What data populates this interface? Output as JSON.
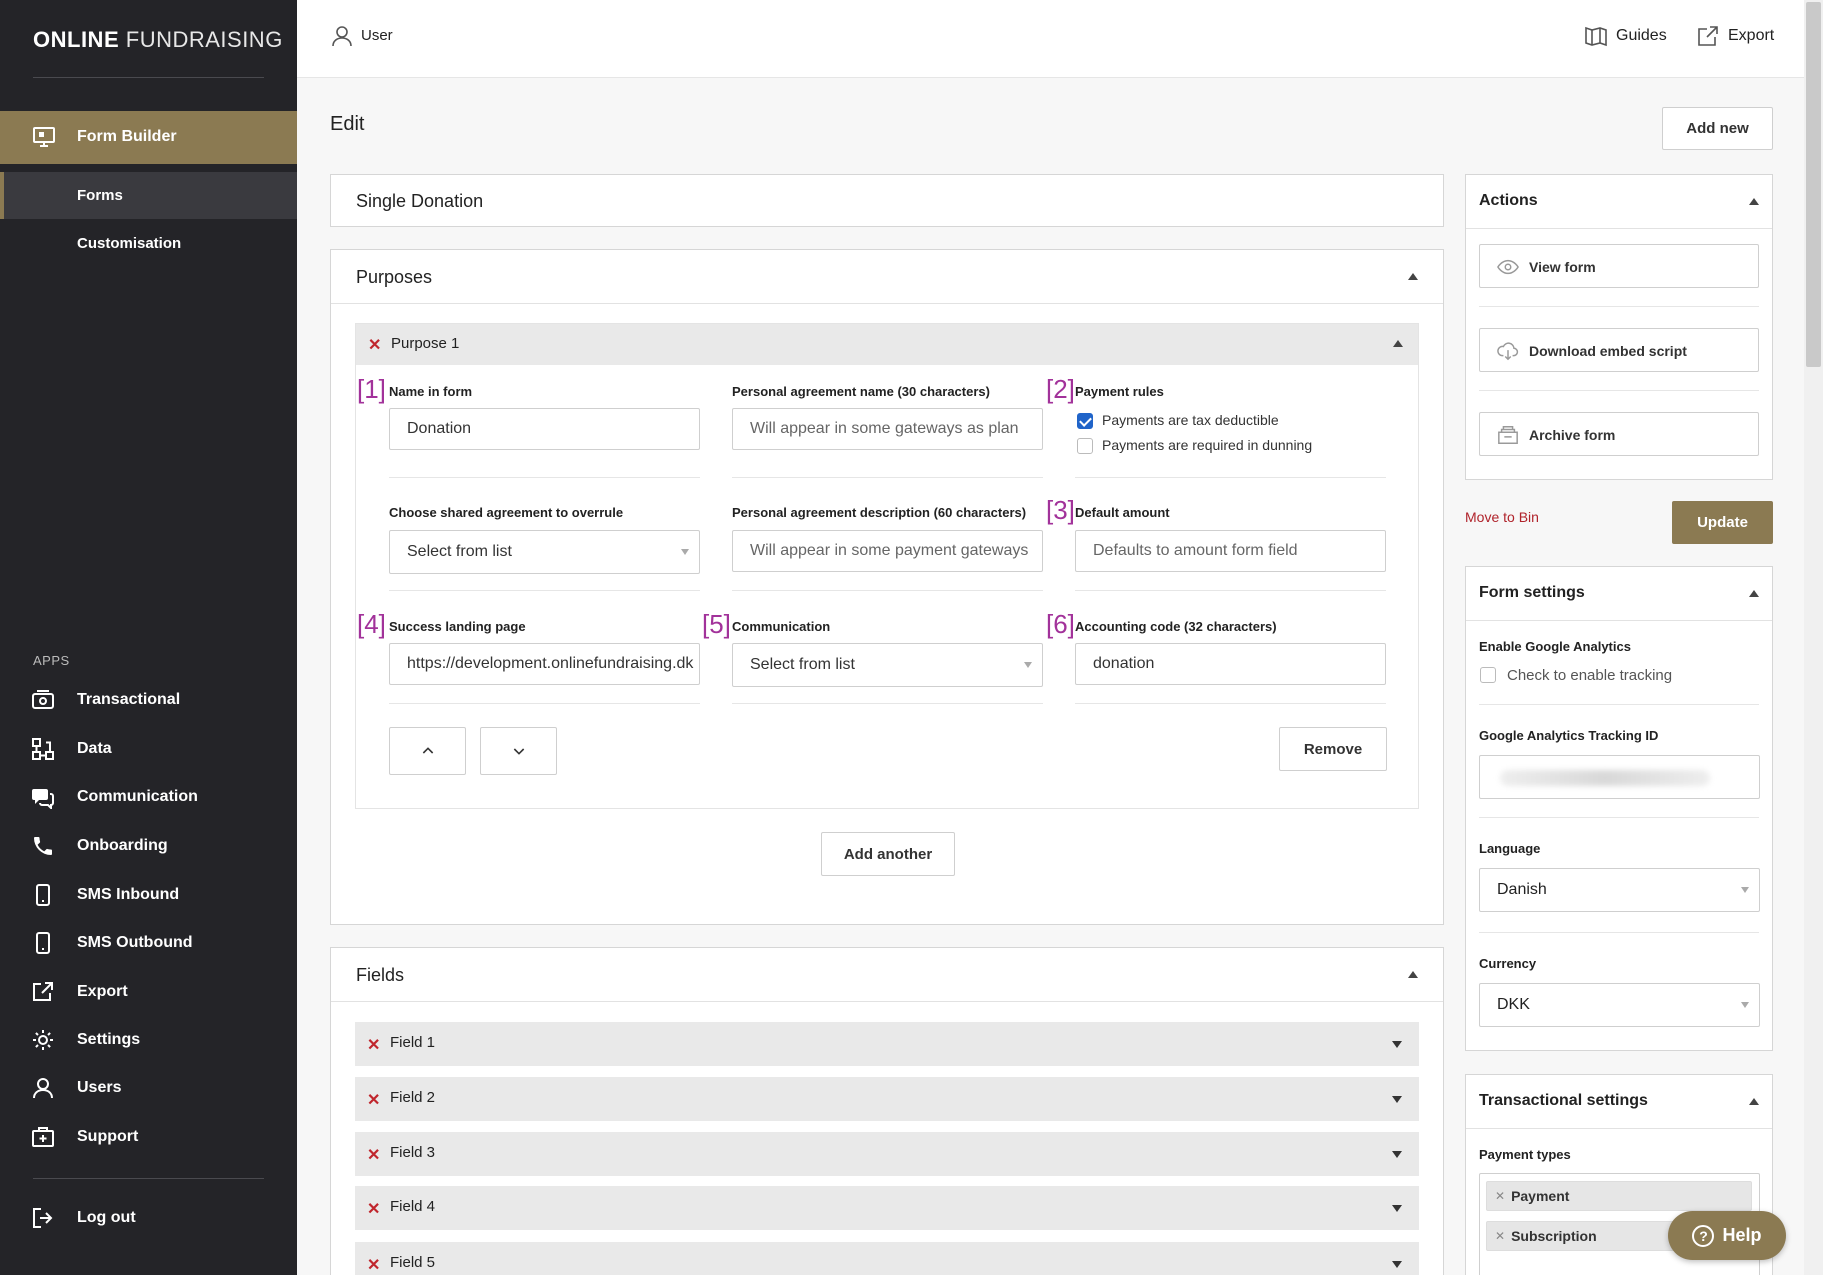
{
  "brand": {
    "bold": "ONLINE",
    "rest": "FUNDRAISING"
  },
  "sidebar": {
    "main_item": "Form Builder",
    "sub_items": [
      "Forms",
      "Customisation"
    ],
    "apps_label": "APPS",
    "apps": [
      "Transactional",
      "Data",
      "Communication",
      "Onboarding",
      "SMS Inbound",
      "SMS Outbound",
      "Export",
      "Settings",
      "Users",
      "Support"
    ],
    "logout": "Log out"
  },
  "topbar": {
    "user": "User",
    "guides": "Guides",
    "export": "Export"
  },
  "page": {
    "title": "Edit",
    "add_new": "Add new",
    "form_name": "Single Donation"
  },
  "purposes": {
    "title": "Purposes",
    "purpose_label": "Purpose 1",
    "markers": [
      "[1]",
      "[2]",
      "[3]",
      "[4]",
      "[5]",
      "[6]"
    ],
    "name_in_form": {
      "label": "Name in form",
      "value": "Donation"
    },
    "agreement_name": {
      "label": "Personal agreement name (30 characters)",
      "placeholder": "Will appear in some gateways as plan"
    },
    "payment_rules": {
      "label": "Payment rules",
      "tax": "Payments are tax deductible",
      "dunning": "Payments are required in dunning",
      "tax_checked": true,
      "dunning_checked": false
    },
    "shared_agreement": {
      "label": "Choose shared agreement to overrule",
      "value": "Select from list"
    },
    "agreement_desc": {
      "label": "Personal agreement description (60 characters)",
      "placeholder": "Will appear in some payment gateways"
    },
    "default_amount": {
      "label": "Default amount",
      "placeholder": "Defaults to amount form field"
    },
    "success_page": {
      "label": "Success landing page",
      "value": "https://development.onlinefundraising.dk"
    },
    "communication": {
      "label": "Communication",
      "value": "Select from list"
    },
    "accounting": {
      "label": "Accounting code (32 characters)",
      "value": "donation"
    },
    "remove": "Remove",
    "add_another": "Add another"
  },
  "fields": {
    "title": "Fields",
    "items": [
      "Field 1",
      "Field 2",
      "Field 3",
      "Field 4",
      "Field 5"
    ]
  },
  "actions": {
    "title": "Actions",
    "view": "View form",
    "download": "Download embed script",
    "archive": "Archive form",
    "move_bin": "Move to Bin",
    "update": "Update"
  },
  "form_settings": {
    "title": "Form settings",
    "ga_label": "Enable Google Analytics",
    "ga_check": "Check to enable tracking",
    "ga_id_label": "Google Analytics Tracking ID",
    "language_label": "Language",
    "language": "Danish",
    "currency_label": "Currency",
    "currency": "DKK"
  },
  "transactional": {
    "title": "Transactional settings",
    "payment_types_label": "Payment types",
    "types": [
      "Payment",
      "Subscription"
    ]
  },
  "help": "Help",
  "colors": {
    "accent": "#8b7a52",
    "sidebar": "#242428",
    "danger": "#c0262d",
    "marker": "#a2329a"
  }
}
